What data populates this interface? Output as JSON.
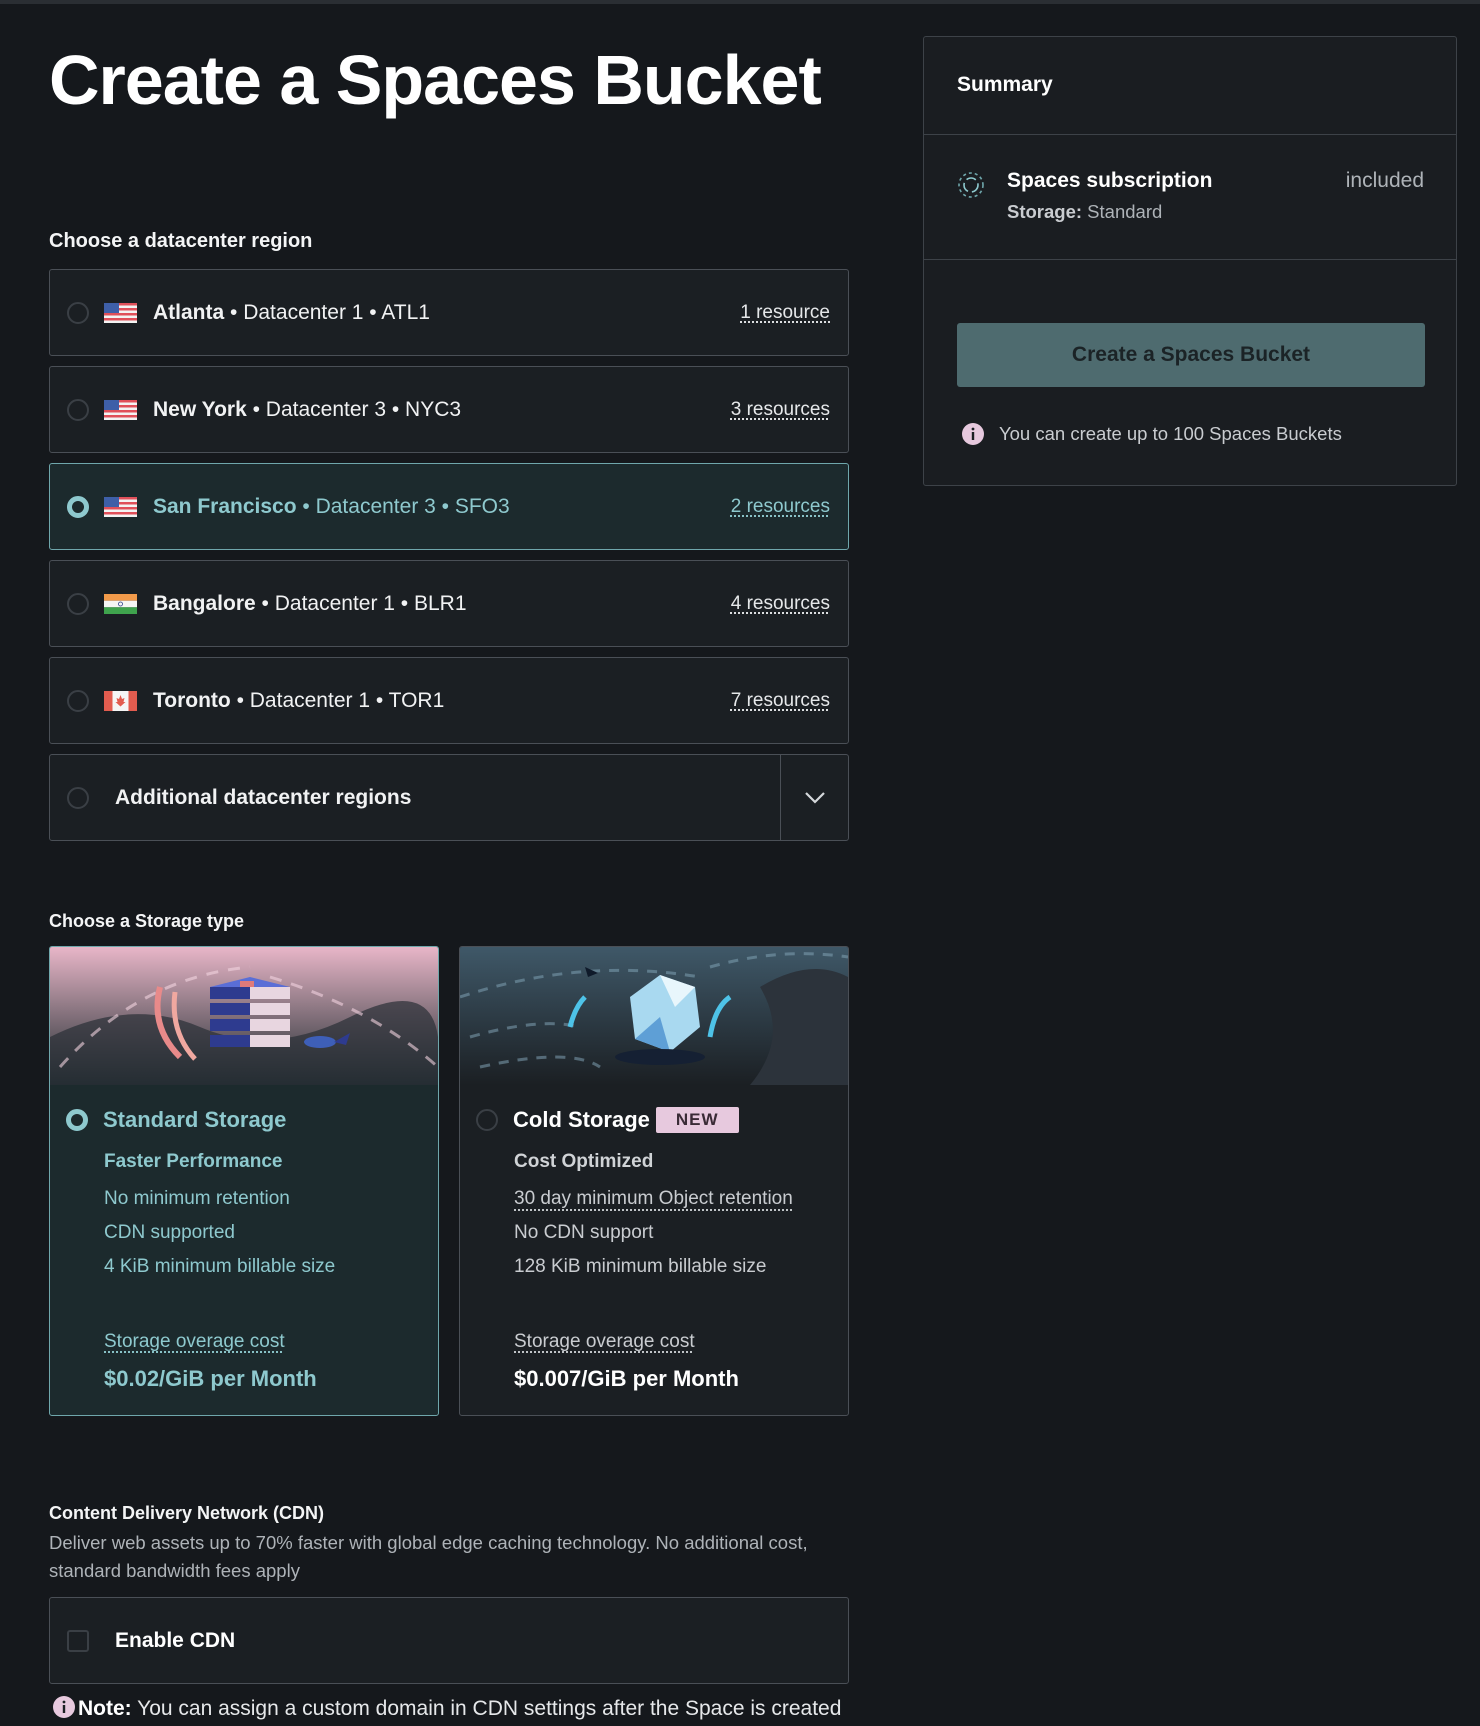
{
  "page": {
    "title": "Create a Spaces Bucket"
  },
  "region_section": {
    "title": "Choose a datacenter region",
    "regions": [
      {
        "city": "Atlanta",
        "detail": " • Datacenter 1 • ATL1",
        "resources": "1 resource",
        "flag": "us-flag-icon",
        "selected": false
      },
      {
        "city": "New York",
        "detail": " • Datacenter 3 • NYC3",
        "resources": "3 resources",
        "flag": "us-flag-icon",
        "selected": false
      },
      {
        "city": "San Francisco",
        "detail": " • Datacenter 3 • SFO3",
        "resources": "2 resources",
        "flag": "us-flag-icon",
        "selected": true
      },
      {
        "city": "Bangalore",
        "detail": " • Datacenter 1 • BLR1",
        "resources": "4 resources",
        "flag": "india-flag-icon",
        "selected": false
      },
      {
        "city": "Toronto",
        "detail": " • Datacenter 1 • TOR1",
        "resources": "7 resources",
        "flag": "canada-flag-icon",
        "selected": false
      }
    ],
    "additional_label": "Additional datacenter regions"
  },
  "storage_section": {
    "title": "Choose a Storage type",
    "standard": {
      "name": "Standard Storage",
      "subtitle": "Faster Performance",
      "features": [
        "No minimum retention",
        "CDN supported",
        "4 KiB minimum billable size"
      ],
      "overage_label": "Storage overage cost",
      "price": "$0.02/GiB per Month",
      "selected": true
    },
    "cold": {
      "name": "Cold Storage",
      "badge": "NEW",
      "subtitle": "Cost Optimized",
      "features": [
        "30 day minimum Object retention",
        "No CDN support",
        "128 KiB minimum billable size"
      ],
      "overage_label": "Storage overage cost",
      "price": "$0.007/GiB per Month",
      "selected": false
    }
  },
  "cdn_section": {
    "title": "Content Delivery Network (CDN)",
    "description": "Deliver web assets up to 70% faster with global edge caching technology. No additional cost, standard bandwidth fees apply",
    "checkbox_label": "Enable CDN",
    "note_label": "Note:",
    "note_text": " You can assign a custom domain in CDN settings after the Space is created"
  },
  "summary": {
    "title": "Summary",
    "subscription_name": "Spaces subscription",
    "storage_label": "Storage:",
    "storage_value": " Standard",
    "included": "included",
    "button_label": "Create a Spaces Bucket",
    "limit_text": "You can create up to 100 Spaces Buckets"
  },
  "colors": {
    "background": "#15181c",
    "accent": "#8ec9ce",
    "badge": "#e7c9de",
    "button": "#4e6b6f"
  }
}
